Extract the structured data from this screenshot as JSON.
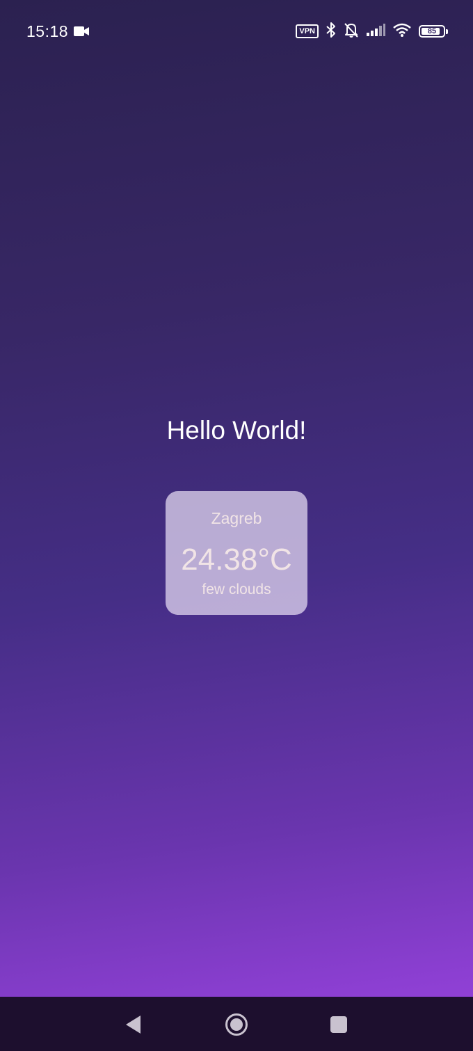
{
  "status_bar": {
    "time": "15:18",
    "vpn_label": "VPN",
    "battery_level": 85,
    "battery_label": "85",
    "icons": [
      "video-camera-icon",
      "vpn-icon",
      "bluetooth-icon",
      "notifications-off-icon",
      "signal-icon",
      "wifi-icon",
      "battery-icon"
    ]
  },
  "main": {
    "greeting": "Hello World!",
    "weather": {
      "city": "Zagreb",
      "temperature": "24.38°C",
      "description": "few clouds"
    }
  },
  "nav_bar": {
    "icons": [
      "back-icon",
      "home-icon",
      "recents-icon"
    ]
  },
  "colors": {
    "background_top": "#2b2150",
    "background_bottom": "#9a44dc",
    "card_background": "#c8bde0",
    "card_text": "#f1e4e6",
    "nav_bar": "#1d0f2e"
  }
}
